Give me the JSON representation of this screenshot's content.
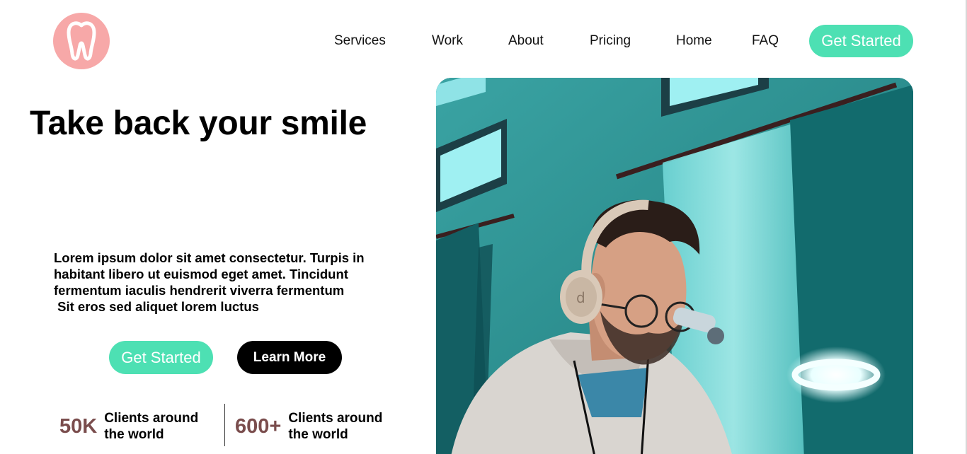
{
  "brand": {
    "logo_icon": "tooth-icon",
    "logo_color": "#f7a8a8"
  },
  "nav": {
    "items": [
      "Services",
      "Work",
      "About",
      "Pricing",
      "Home",
      "FAQ"
    ],
    "cta_label": "Get Started"
  },
  "hero": {
    "title": "Take back your smile",
    "description_lines": [
      "Lorem ipsum dolor sit amet consectetur. Turpis in",
      "habitant libero ut euismod eget amet. Tincidunt",
      "fermentum iaculis hendrerit viverra fermentum",
      " Sit eros sed aliquet lorem luctus"
    ],
    "primary_label": "Get Started",
    "secondary_label": "Learn More"
  },
  "stats": [
    {
      "number": "50K",
      "label_line1": "Clients around",
      "label_line2": "the world"
    },
    {
      "number": "600+",
      "label_line1": "Clients around",
      "label_line2": "the world"
    }
  ],
  "colors": {
    "accent": "#4de0b3",
    "stat_number": "#7a4d4d",
    "dark_button": "#000000"
  },
  "hero_image": {
    "subject": "man-with-headphones-and-dental-loupes"
  }
}
